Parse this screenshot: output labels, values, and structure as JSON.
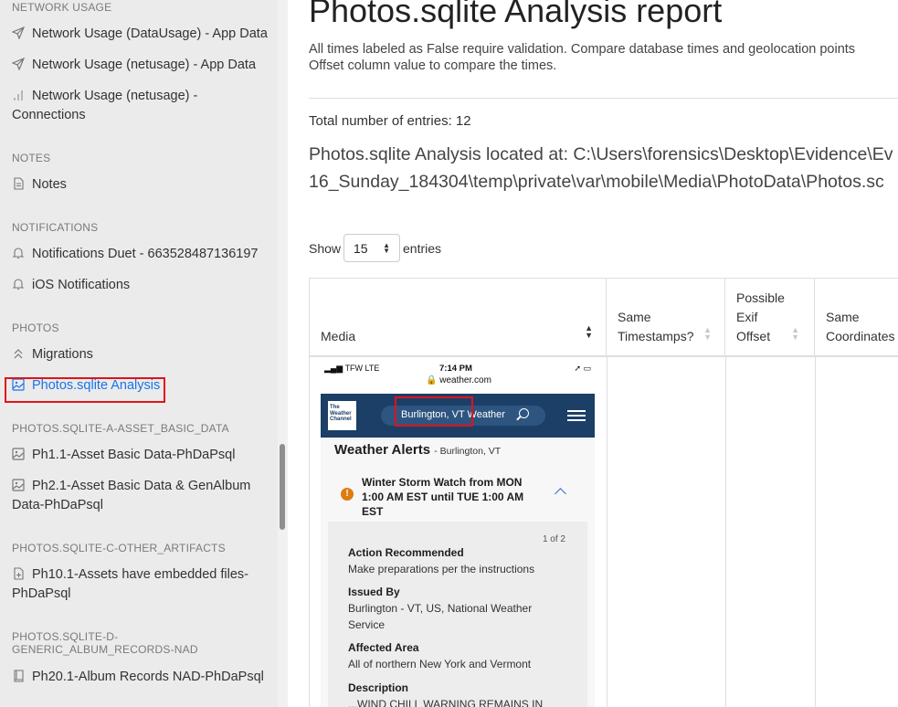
{
  "sidebar": {
    "sections": [
      {
        "heading": "NETWORK USAGE",
        "items": [
          {
            "label": "Network Usage (DataUsage) - App Data",
            "icon": "send-icon"
          },
          {
            "label": "Network Usage (netusage) - App Data",
            "icon": "send-icon"
          },
          {
            "label": "Network Usage (netusage) - Connections",
            "icon": "bar-chart-icon"
          }
        ]
      },
      {
        "heading": "NOTES",
        "items": [
          {
            "label": "Notes",
            "icon": "file-text-icon"
          }
        ]
      },
      {
        "heading": "NOTIFICATIONS",
        "items": [
          {
            "label": "Notifications Duet - 663528487136197",
            "icon": "bell-icon"
          },
          {
            "label": "iOS Notifications",
            "icon": "bell-icon"
          }
        ]
      },
      {
        "heading": "PHOTOS",
        "items": [
          {
            "label": "Migrations",
            "icon": "chevrons-up-icon"
          },
          {
            "label": "Photos.sqlite Analysis",
            "icon": "image-icon",
            "active": true
          }
        ]
      },
      {
        "heading": "PHOTOS.SQLITE-A-ASSET_BASIC_DATA",
        "items": [
          {
            "label": "Ph1.1-Asset Basic Data-PhDaPsql",
            "icon": "image-icon"
          },
          {
            "label": "Ph2.1-Asset Basic Data & GenAlbum Data-PhDaPsql",
            "icon": "image-icon"
          }
        ]
      },
      {
        "heading": "PHOTOS.SQLITE-C-OTHER_ARTIFACTS",
        "items": [
          {
            "label": "Ph10.1-Assets have embedded files-PhDaPsql",
            "icon": "file-plus-icon"
          }
        ]
      },
      {
        "heading": "PHOTOS.SQLITE-D-GENERIC_ALBUM_RECORDS-NAD",
        "items": [
          {
            "label": "Ph20.1-Album Records NAD-PhDaPsql",
            "icon": "book-icon"
          }
        ]
      }
    ]
  },
  "report": {
    "title": "Photos.sqlite Analysis report",
    "description_line1": "All times labeled as False require validation. Compare database times and geolocation points",
    "description_line2": "Offset column value to compare the times.",
    "total_entries": "Total number of entries: 12",
    "located_line1": "Photos.sqlite Analysis located at: C:\\Users\\forensics\\Desktop\\Evidence\\Ev",
    "located_line2": "16_Sunday_184304\\temp\\private\\var\\mobile\\Media\\PhotoData\\Photos.sc"
  },
  "table_controls": {
    "show_label": "Show",
    "page_size": "15",
    "entries_label": "entries"
  },
  "table": {
    "columns": [
      {
        "label": "Media"
      },
      {
        "label_lines": [
          "Same",
          "Timestamps?"
        ]
      },
      {
        "label_lines": [
          "Possible",
          "Exif",
          "Offset"
        ]
      },
      {
        "label_lines": [
          "Same",
          "Coordinates"
        ]
      }
    ]
  },
  "media_screenshot": {
    "status_left": "TFW  LTE",
    "time": "7:14 PM",
    "url": "weather.com",
    "logo_text": [
      "The",
      "Weather",
      "Channel"
    ],
    "search_text": "Burlington, VT Weather",
    "alerts_heading": "Weather Alerts",
    "alerts_location": "- Burlington, VT",
    "watch_text": "Winter Storm Watch from MON 1:00 AM EST until TUE 1:00 AM EST",
    "warn_symbol": "!",
    "page_of": "1 of 2",
    "action_heading": "Action Recommended",
    "action_text": "Make preparations per the instructions",
    "issued_heading": "Issued By",
    "issued_text": "Burlington - VT, US, National Weather Service",
    "area_heading": "Affected Area",
    "area_text": "All of northern New York and Vermont",
    "desc_heading": "Description",
    "desc_text": "...WIND CHILL WARNING REMAINS IN"
  },
  "colors": {
    "sidebar_bg": "#ebebeb",
    "active_link": "#1a73e8",
    "highlight_box": "#e0121b",
    "weather_bar": "#1b3f66"
  }
}
